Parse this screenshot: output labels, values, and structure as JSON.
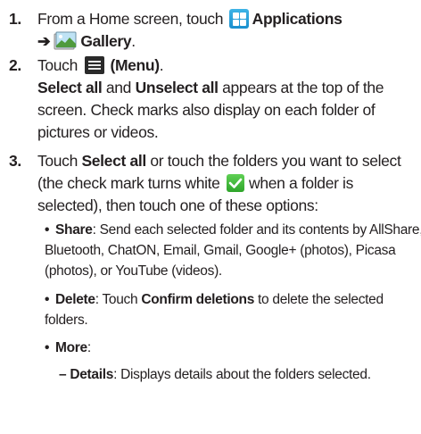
{
  "steps": [
    {
      "number": "1.",
      "line1": {
        "prefix": "From a Home screen, touch",
        "icon": "applications-grid-icon",
        "label": "Applications"
      },
      "line2": {
        "arrow": "➔",
        "icon": "gallery-icon",
        "label": "Gallery",
        "suffix": "."
      }
    },
    {
      "number": "2.",
      "line1": {
        "prefix": "Touch",
        "icon": "menu-icon",
        "label": "(Menu)",
        "suffix": "."
      },
      "para": {
        "select_all": "Select all",
        "and": "and",
        "unselect_all": "Unselect all",
        "rest1": "appears at the top of the",
        "line2": "screen. Check marks also display on each folder of",
        "line3": "pictures or videos."
      }
    },
    {
      "number": "3.",
      "line1_prefix": "Touch",
      "line1_bold": "Select all",
      "line1_rest": "or touch the folders you want to select",
      "line2_prefix": "(the check mark turns white",
      "check_icon": "check-mark-icon",
      "line2_rest": "when a folder is",
      "line3": "selected), then touch one of these options:"
    }
  ],
  "options": [
    {
      "bullet": "•",
      "label": "Share",
      "lines": [
        ": Send each selected folder and its contents by AllShare,",
        "Bluetooth, ChatON, Email, Gmail, Google+ (photos), Picasa",
        "(photos), or YouTube (videos)."
      ]
    },
    {
      "bullet": "•",
      "label": "Delete",
      "pre": ": Touch",
      "bold": "Confirm deletions",
      "post": "to delete the selected",
      "line2": "folders."
    },
    {
      "bullet": "•",
      "label": "More",
      "suffix": ":"
    }
  ],
  "sub_options": [
    {
      "dash": "–",
      "label": "Details",
      "text": ": Displays details about the folders selected."
    }
  ],
  "colors": {
    "text": "#231f20",
    "applications_icon": "#2aa3dc",
    "check_icon": "#3cb73a",
    "menu_icon": "#2a2a2a"
  }
}
